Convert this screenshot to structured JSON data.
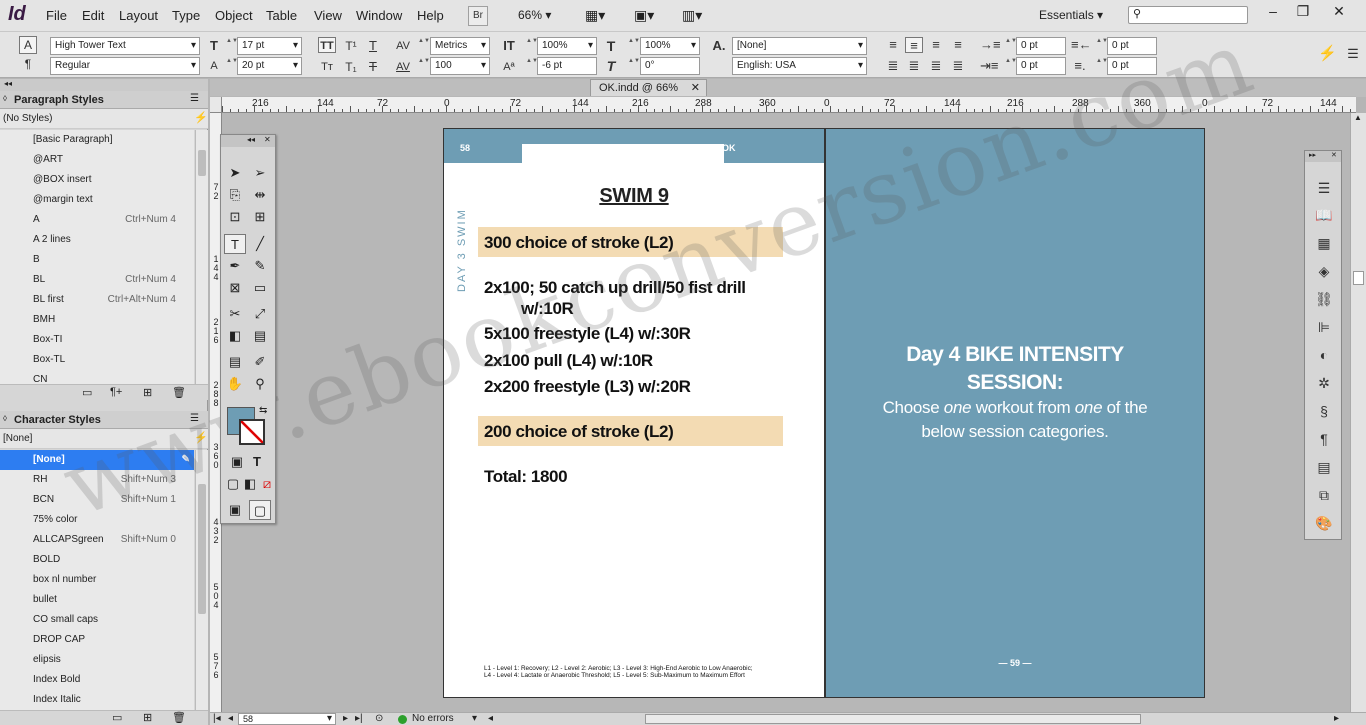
{
  "app": {
    "logo": "Id"
  },
  "menubar": {
    "items": [
      "File",
      "Edit",
      "Layout",
      "Type",
      "Object",
      "Table",
      "View",
      "Window",
      "Help"
    ],
    "bridge_label": "Br",
    "zoom": "66%",
    "workspace": "Essentials"
  },
  "control": {
    "font_family": "High Tower Text",
    "font_style": "Regular",
    "font_size": "17 pt",
    "leading": "20 pt",
    "kerning": "Metrics",
    "tracking": "100",
    "vscale": "100%",
    "hscale": "100%",
    "baseline": "-6 pt",
    "skew": "0°",
    "char_style": "[None]",
    "language": "English: USA",
    "indent_left": "0 pt",
    "indent_right": "0 pt",
    "first_indent": "0 pt",
    "last_indent": "0 pt"
  },
  "paragraph_styles": {
    "title": "Paragraph Styles",
    "current": "(No Styles)",
    "items": [
      {
        "name": "[Basic Paragraph]",
        "shortcut": ""
      },
      {
        "name": "@ART",
        "shortcut": ""
      },
      {
        "name": "@BOX insert",
        "shortcut": ""
      },
      {
        "name": "@margin text",
        "shortcut": ""
      },
      {
        "name": "A",
        "shortcut": "Ctrl+Num 4"
      },
      {
        "name": "A 2 lines",
        "shortcut": ""
      },
      {
        "name": "B",
        "shortcut": ""
      },
      {
        "name": "BL",
        "shortcut": "Ctrl+Num 4"
      },
      {
        "name": "BL first",
        "shortcut": "Ctrl+Alt+Num 4"
      },
      {
        "name": "BMH",
        "shortcut": ""
      },
      {
        "name": "Box-TI",
        "shortcut": ""
      },
      {
        "name": "Box-TL",
        "shortcut": ""
      },
      {
        "name": "CN",
        "shortcut": ""
      }
    ]
  },
  "character_styles": {
    "title": "Character Styles",
    "current": "[None]",
    "items": [
      {
        "name": "[None]",
        "shortcut": ""
      },
      {
        "name": "RH",
        "shortcut": "Shift+Num 3"
      },
      {
        "name": "BCN",
        "shortcut": "Shift+Num 1"
      },
      {
        "name": "75% color",
        "shortcut": ""
      },
      {
        "name": "ALLCAPSgreen",
        "shortcut": "Shift+Num 0"
      },
      {
        "name": "BOLD",
        "shortcut": ""
      },
      {
        "name": "box nl number",
        "shortcut": ""
      },
      {
        "name": "bullet",
        "shortcut": ""
      },
      {
        "name": "CO small caps",
        "shortcut": ""
      },
      {
        "name": "DROP CAP",
        "shortcut": ""
      },
      {
        "name": "elipsis",
        "shortcut": ""
      },
      {
        "name": "Index Bold",
        "shortcut": ""
      },
      {
        "name": "Index Italic",
        "shortcut": ""
      }
    ]
  },
  "document": {
    "tab_title": "OK.indd @ 66%",
    "ruler_labels": [
      "216",
      "144",
      "72",
      "0",
      "72",
      "144",
      "216",
      "288",
      "360",
      "0",
      "72",
      "144",
      "216",
      "288",
      "360",
      "0",
      "72",
      "144"
    ],
    "ruler_v_labels": [
      "7\n2",
      "1\n4\n4",
      "2\n1\n6",
      "2\n8\n8",
      "3\n6\n0",
      "4\n3\n2",
      "5\n0\n4",
      "5\n7\n6"
    ],
    "left_page": {
      "folio": "58",
      "header_fragment": "OK",
      "side_label": "DAY 3 SWIM",
      "title": "SWIM 9",
      "highlight_1": "300 choice of stroke (L2)",
      "lines": [
        "2x100; 50 catch up drill/50 fist drill",
        "w/:10R",
        "5x100 freestyle (L4) w/:30R",
        "2x100 pull (L4) w/:10R",
        "2x200 freestyle (L3) w/:20R"
      ],
      "highlight_2": "200 choice of stroke (L2)",
      "total": "Total: 1800",
      "footnote_1": "L1 - Level 1: Recovery; L2 - Level 2: Aerobic; L3 - Level 3: High-End Aerobic to Low Anaerobic;",
      "footnote_2": "L4 - Level 4: Lactate or Anaerobic Threshold; L5 - Level 5: Sub-Maximum to Maximum Effort"
    },
    "right_page": {
      "title_1": "Day 4 BIKE INTENSITY",
      "title_2": "SESSION:",
      "sub_1a": "Choose ",
      "sub_1b": "one",
      "sub_1c": " workout from ",
      "sub_1d": "one",
      "sub_1e": " of the",
      "sub_2": "below session categories.",
      "folio": "— 59 —"
    },
    "watermark": "www.ebookconversion.com"
  },
  "status": {
    "page": "58",
    "errors": "No errors"
  },
  "colors": {
    "accent": "#6e9db4",
    "highlight": "#f3dbb3",
    "selection": "#2d7df1"
  }
}
